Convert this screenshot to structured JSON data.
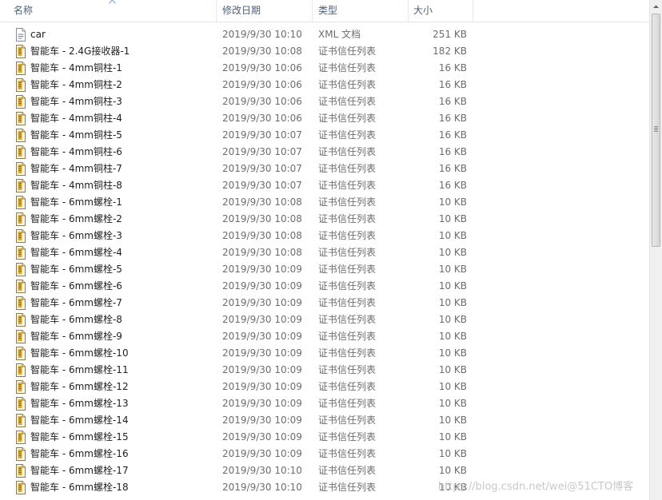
{
  "columns": {
    "name": "名称",
    "date": "修改日期",
    "type": "类型",
    "size": "大小"
  },
  "rows": [
    {
      "icon": "xml-file-icon",
      "name": "car",
      "date": "2019/9/30 10:10",
      "type": "XML 文档",
      "size": "251 KB"
    },
    {
      "icon": "certificate-trust-list-icon",
      "name": "智能车 - 2.4G接收器-1",
      "date": "2019/9/30 10:08",
      "type": "证书信任列表",
      "size": "182 KB"
    },
    {
      "icon": "certificate-trust-list-icon",
      "name": "智能车 - 4mm铜柱-1",
      "date": "2019/9/30 10:06",
      "type": "证书信任列表",
      "size": "16 KB"
    },
    {
      "icon": "certificate-trust-list-icon",
      "name": "智能车 - 4mm铜柱-2",
      "date": "2019/9/30 10:06",
      "type": "证书信任列表",
      "size": "16 KB"
    },
    {
      "icon": "certificate-trust-list-icon",
      "name": "智能车 - 4mm铜柱-3",
      "date": "2019/9/30 10:06",
      "type": "证书信任列表",
      "size": "16 KB"
    },
    {
      "icon": "certificate-trust-list-icon",
      "name": "智能车 - 4mm铜柱-4",
      "date": "2019/9/30 10:06",
      "type": "证书信任列表",
      "size": "16 KB"
    },
    {
      "icon": "certificate-trust-list-icon",
      "name": "智能车 - 4mm铜柱-5",
      "date": "2019/9/30 10:07",
      "type": "证书信任列表",
      "size": "16 KB"
    },
    {
      "icon": "certificate-trust-list-icon",
      "name": "智能车 - 4mm铜柱-6",
      "date": "2019/9/30 10:07",
      "type": "证书信任列表",
      "size": "16 KB"
    },
    {
      "icon": "certificate-trust-list-icon",
      "name": "智能车 - 4mm铜柱-7",
      "date": "2019/9/30 10:07",
      "type": "证书信任列表",
      "size": "16 KB"
    },
    {
      "icon": "certificate-trust-list-icon",
      "name": "智能车 - 4mm铜柱-8",
      "date": "2019/9/30 10:07",
      "type": "证书信任列表",
      "size": "16 KB"
    },
    {
      "icon": "certificate-trust-list-icon",
      "name": "智能车 - 6mm螺栓-1",
      "date": "2019/9/30 10:08",
      "type": "证书信任列表",
      "size": "10 KB"
    },
    {
      "icon": "certificate-trust-list-icon",
      "name": "智能车 - 6mm螺栓-2",
      "date": "2019/9/30 10:08",
      "type": "证书信任列表",
      "size": "10 KB"
    },
    {
      "icon": "certificate-trust-list-icon",
      "name": "智能车 - 6mm螺栓-3",
      "date": "2019/9/30 10:08",
      "type": "证书信任列表",
      "size": "10 KB"
    },
    {
      "icon": "certificate-trust-list-icon",
      "name": "智能车 - 6mm螺栓-4",
      "date": "2019/9/30 10:08",
      "type": "证书信任列表",
      "size": "10 KB"
    },
    {
      "icon": "certificate-trust-list-icon",
      "name": "智能车 - 6mm螺栓-5",
      "date": "2019/9/30 10:09",
      "type": "证书信任列表",
      "size": "10 KB"
    },
    {
      "icon": "certificate-trust-list-icon",
      "name": "智能车 - 6mm螺栓-6",
      "date": "2019/9/30 10:09",
      "type": "证书信任列表",
      "size": "10 KB"
    },
    {
      "icon": "certificate-trust-list-icon",
      "name": "智能车 - 6mm螺栓-7",
      "date": "2019/9/30 10:09",
      "type": "证书信任列表",
      "size": "10 KB"
    },
    {
      "icon": "certificate-trust-list-icon",
      "name": "智能车 - 6mm螺栓-8",
      "date": "2019/9/30 10:09",
      "type": "证书信任列表",
      "size": "10 KB"
    },
    {
      "icon": "certificate-trust-list-icon",
      "name": "智能车 - 6mm螺栓-9",
      "date": "2019/9/30 10:09",
      "type": "证书信任列表",
      "size": "10 KB"
    },
    {
      "icon": "certificate-trust-list-icon",
      "name": "智能车 - 6mm螺栓-10",
      "date": "2019/9/30 10:09",
      "type": "证书信任列表",
      "size": "10 KB"
    },
    {
      "icon": "certificate-trust-list-icon",
      "name": "智能车 - 6mm螺栓-11",
      "date": "2019/9/30 10:09",
      "type": "证书信任列表",
      "size": "10 KB"
    },
    {
      "icon": "certificate-trust-list-icon",
      "name": "智能车 - 6mm螺栓-12",
      "date": "2019/9/30 10:09",
      "type": "证书信任列表",
      "size": "10 KB"
    },
    {
      "icon": "certificate-trust-list-icon",
      "name": "智能车 - 6mm螺栓-13",
      "date": "2019/9/30 10:09",
      "type": "证书信任列表",
      "size": "10 KB"
    },
    {
      "icon": "certificate-trust-list-icon",
      "name": "智能车 - 6mm螺栓-14",
      "date": "2019/9/30 10:09",
      "type": "证书信任列表",
      "size": "10 KB"
    },
    {
      "icon": "certificate-trust-list-icon",
      "name": "智能车 - 6mm螺栓-15",
      "date": "2019/9/30 10:09",
      "type": "证书信任列表",
      "size": "10 KB"
    },
    {
      "icon": "certificate-trust-list-icon",
      "name": "智能车 - 6mm螺栓-16",
      "date": "2019/9/30 10:09",
      "type": "证书信任列表",
      "size": "10 KB"
    },
    {
      "icon": "certificate-trust-list-icon",
      "name": "智能车 - 6mm螺栓-17",
      "date": "2019/9/30 10:10",
      "type": "证书信任列表",
      "size": "10 KB"
    },
    {
      "icon": "certificate-trust-list-icon",
      "name": "智能车 - 6mm螺栓-18",
      "date": "2019/9/30 10:10",
      "type": "证书信任列表",
      "size": "10 KB"
    }
  ],
  "watermark": "https://blog.csdn.net/wei@51CTO博客",
  "colors": {
    "header_text": "#4c607a",
    "name_text": "#1e1e1e",
    "detail_text": "#6d6d6d",
    "icon_accent": "#d9a92c"
  }
}
